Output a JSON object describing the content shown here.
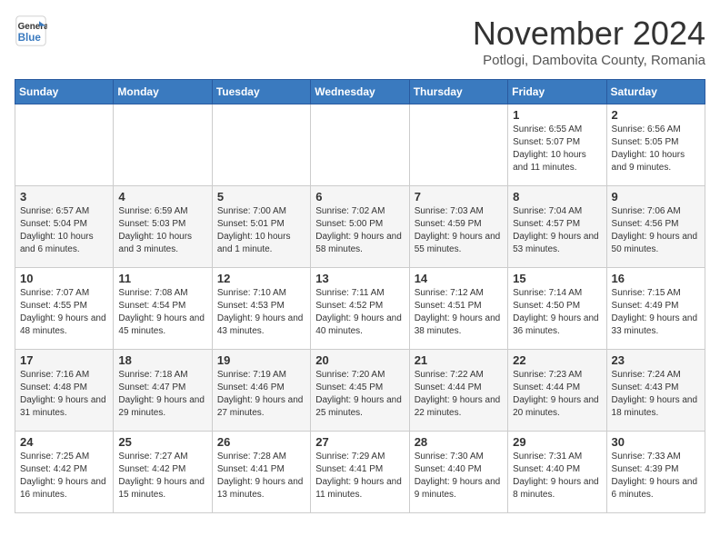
{
  "header": {
    "logo_line1": "General",
    "logo_line2": "Blue",
    "month": "November 2024",
    "location": "Potlogi, Dambovita County, Romania"
  },
  "weekdays": [
    "Sunday",
    "Monday",
    "Tuesday",
    "Wednesday",
    "Thursday",
    "Friday",
    "Saturday"
  ],
  "weeks": [
    [
      {
        "day": "",
        "info": ""
      },
      {
        "day": "",
        "info": ""
      },
      {
        "day": "",
        "info": ""
      },
      {
        "day": "",
        "info": ""
      },
      {
        "day": "",
        "info": ""
      },
      {
        "day": "1",
        "info": "Sunrise: 6:55 AM\nSunset: 5:07 PM\nDaylight: 10 hours and 11 minutes."
      },
      {
        "day": "2",
        "info": "Sunrise: 6:56 AM\nSunset: 5:05 PM\nDaylight: 10 hours and 9 minutes."
      }
    ],
    [
      {
        "day": "3",
        "info": "Sunrise: 6:57 AM\nSunset: 5:04 PM\nDaylight: 10 hours and 6 minutes."
      },
      {
        "day": "4",
        "info": "Sunrise: 6:59 AM\nSunset: 5:03 PM\nDaylight: 10 hours and 3 minutes."
      },
      {
        "day": "5",
        "info": "Sunrise: 7:00 AM\nSunset: 5:01 PM\nDaylight: 10 hours and 1 minute."
      },
      {
        "day": "6",
        "info": "Sunrise: 7:02 AM\nSunset: 5:00 PM\nDaylight: 9 hours and 58 minutes."
      },
      {
        "day": "7",
        "info": "Sunrise: 7:03 AM\nSunset: 4:59 PM\nDaylight: 9 hours and 55 minutes."
      },
      {
        "day": "8",
        "info": "Sunrise: 7:04 AM\nSunset: 4:57 PM\nDaylight: 9 hours and 53 minutes."
      },
      {
        "day": "9",
        "info": "Sunrise: 7:06 AM\nSunset: 4:56 PM\nDaylight: 9 hours and 50 minutes."
      }
    ],
    [
      {
        "day": "10",
        "info": "Sunrise: 7:07 AM\nSunset: 4:55 PM\nDaylight: 9 hours and 48 minutes."
      },
      {
        "day": "11",
        "info": "Sunrise: 7:08 AM\nSunset: 4:54 PM\nDaylight: 9 hours and 45 minutes."
      },
      {
        "day": "12",
        "info": "Sunrise: 7:10 AM\nSunset: 4:53 PM\nDaylight: 9 hours and 43 minutes."
      },
      {
        "day": "13",
        "info": "Sunrise: 7:11 AM\nSunset: 4:52 PM\nDaylight: 9 hours and 40 minutes."
      },
      {
        "day": "14",
        "info": "Sunrise: 7:12 AM\nSunset: 4:51 PM\nDaylight: 9 hours and 38 minutes."
      },
      {
        "day": "15",
        "info": "Sunrise: 7:14 AM\nSunset: 4:50 PM\nDaylight: 9 hours and 36 minutes."
      },
      {
        "day": "16",
        "info": "Sunrise: 7:15 AM\nSunset: 4:49 PM\nDaylight: 9 hours and 33 minutes."
      }
    ],
    [
      {
        "day": "17",
        "info": "Sunrise: 7:16 AM\nSunset: 4:48 PM\nDaylight: 9 hours and 31 minutes."
      },
      {
        "day": "18",
        "info": "Sunrise: 7:18 AM\nSunset: 4:47 PM\nDaylight: 9 hours and 29 minutes."
      },
      {
        "day": "19",
        "info": "Sunrise: 7:19 AM\nSunset: 4:46 PM\nDaylight: 9 hours and 27 minutes."
      },
      {
        "day": "20",
        "info": "Sunrise: 7:20 AM\nSunset: 4:45 PM\nDaylight: 9 hours and 25 minutes."
      },
      {
        "day": "21",
        "info": "Sunrise: 7:22 AM\nSunset: 4:44 PM\nDaylight: 9 hours and 22 minutes."
      },
      {
        "day": "22",
        "info": "Sunrise: 7:23 AM\nSunset: 4:44 PM\nDaylight: 9 hours and 20 minutes."
      },
      {
        "day": "23",
        "info": "Sunrise: 7:24 AM\nSunset: 4:43 PM\nDaylight: 9 hours and 18 minutes."
      }
    ],
    [
      {
        "day": "24",
        "info": "Sunrise: 7:25 AM\nSunset: 4:42 PM\nDaylight: 9 hours and 16 minutes."
      },
      {
        "day": "25",
        "info": "Sunrise: 7:27 AM\nSunset: 4:42 PM\nDaylight: 9 hours and 15 minutes."
      },
      {
        "day": "26",
        "info": "Sunrise: 7:28 AM\nSunset: 4:41 PM\nDaylight: 9 hours and 13 minutes."
      },
      {
        "day": "27",
        "info": "Sunrise: 7:29 AM\nSunset: 4:41 PM\nDaylight: 9 hours and 11 minutes."
      },
      {
        "day": "28",
        "info": "Sunrise: 7:30 AM\nSunset: 4:40 PM\nDaylight: 9 hours and 9 minutes."
      },
      {
        "day": "29",
        "info": "Sunrise: 7:31 AM\nSunset: 4:40 PM\nDaylight: 9 hours and 8 minutes."
      },
      {
        "day": "30",
        "info": "Sunrise: 7:33 AM\nSunset: 4:39 PM\nDaylight: 9 hours and 6 minutes."
      }
    ]
  ]
}
